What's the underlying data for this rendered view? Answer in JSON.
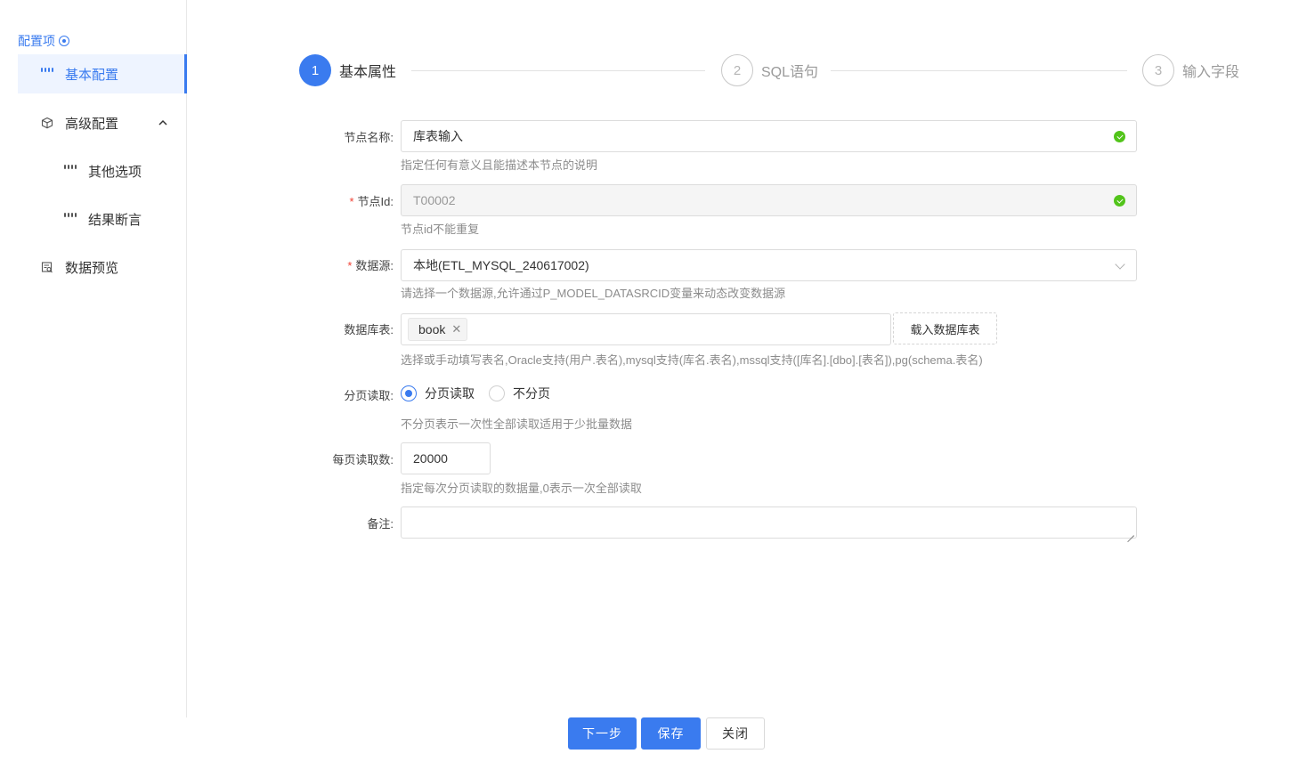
{
  "sidebar": {
    "header": "配置项",
    "items": [
      {
        "label": "基本配置",
        "icon": "grid-icon",
        "active": true
      },
      {
        "label": "高级配置",
        "icon": "cube-icon",
        "expanded": true
      },
      {
        "label": "其他选项",
        "icon": "grid-icon"
      },
      {
        "label": "结果断言",
        "icon": "grid-icon"
      },
      {
        "label": "数据预览",
        "icon": "preview-icon"
      }
    ]
  },
  "steps": [
    {
      "number": "1",
      "title": "基本属性",
      "status": "active"
    },
    {
      "number": "2",
      "title": "SQL语句",
      "status": "wait"
    },
    {
      "number": "3",
      "title": "输入字段",
      "status": "wait"
    }
  ],
  "form": {
    "node_name": {
      "label": "节点名称:",
      "value": "库表输入",
      "help": "指定任何有意义且能描述本节点的说明"
    },
    "node_id": {
      "label": "节点Id:",
      "value": "T00002",
      "help": "节点id不能重复"
    },
    "datasource": {
      "label": "数据源:",
      "value": "本地(ETL_MYSQL_240617002)",
      "help": "请选择一个数据源,允许通过P_MODEL_DATASRCID变量来动态改变数据源"
    },
    "db_table": {
      "label": "数据库表:",
      "tags": [
        "book"
      ],
      "button": "载入数据库表",
      "help": "选择或手动填写表名,Oracle支持(用户.表名),mysql支持(库名.表名),mssql支持([库名].[dbo].[表名]),pg(schema.表名)"
    },
    "paging": {
      "label": "分页读取:",
      "options": [
        "分页读取",
        "不分页"
      ],
      "selected": "分页读取",
      "help": "不分页表示一次性全部读取适用于少批量数据"
    },
    "page_size": {
      "label": "每页读取数:",
      "value": "20000",
      "help": "指定每次分页读取的数据量,0表示一次全部读取"
    },
    "remark": {
      "label": "备注:",
      "value": ""
    }
  },
  "footer": {
    "next": "下一步",
    "save": "保存",
    "close": "关闭"
  },
  "colors": {
    "primary": "#3a7bef",
    "success": "#52c41a",
    "required": "#f04134"
  }
}
